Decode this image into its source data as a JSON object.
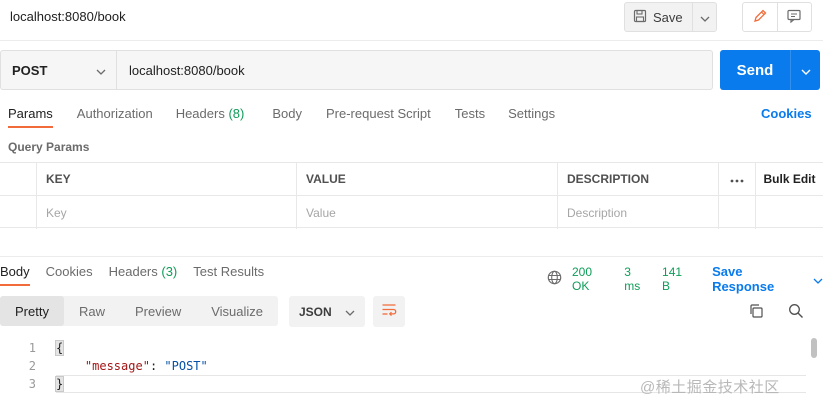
{
  "window": {
    "title": "localhost:8080/book"
  },
  "toolbar": {
    "save_label": "Save"
  },
  "request": {
    "method": "POST",
    "url": "localhost:8080/book",
    "send_label": "Send"
  },
  "request_tabs": [
    {
      "label": "Params",
      "count": "",
      "active": true
    },
    {
      "label": "Authorization",
      "count": ""
    },
    {
      "label": "Headers",
      "count": "(8)"
    },
    {
      "label": "Body",
      "count": ""
    },
    {
      "label": "Pre-request Script",
      "count": ""
    },
    {
      "label": "Tests",
      "count": ""
    },
    {
      "label": "Settings",
      "count": ""
    }
  ],
  "cookies_label": "Cookies",
  "query_params": {
    "title": "Query Params",
    "headers": {
      "key": "KEY",
      "value": "VALUE",
      "description": "DESCRIPTION",
      "more": "ooo",
      "bulk_edit": "Bulk Edit"
    },
    "placeholders": {
      "key": "Key",
      "value": "Value",
      "description": "Description"
    }
  },
  "response_tabs": [
    {
      "label": "Body",
      "count": "",
      "active": true
    },
    {
      "label": "Cookies",
      "count": ""
    },
    {
      "label": "Headers",
      "count": "(3)"
    },
    {
      "label": "Test Results",
      "count": ""
    }
  ],
  "response_status": {
    "status": "200 OK",
    "time": "3 ms",
    "size": "141 B",
    "save_response": "Save Response"
  },
  "format_tabs": [
    {
      "label": "Pretty",
      "active": true
    },
    {
      "label": "Raw"
    },
    {
      "label": "Preview"
    },
    {
      "label": "Visualize"
    }
  ],
  "language_select": "JSON",
  "response_body": {
    "line_numbers": [
      "1",
      "2",
      "3"
    ],
    "open_brace": "{",
    "key": "\"message\"",
    "colon": ": ",
    "value": "\"POST\"",
    "close_brace": "}"
  },
  "watermark": "@稀土掘金技术社区",
  "colors": {
    "accent": "#f26b3a",
    "send_button": "#097bed",
    "status_ok": "#0f9d58",
    "link": "#097bed"
  }
}
